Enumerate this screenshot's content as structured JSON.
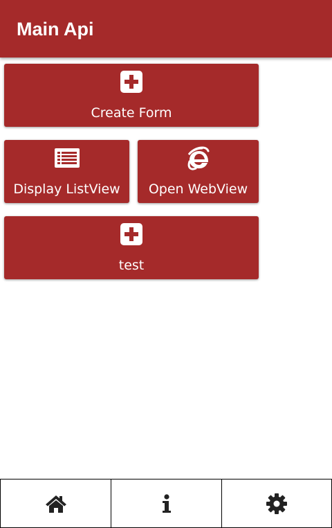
{
  "app": {
    "title": "Main Api"
  },
  "colors": {
    "primary": "#a52a2a",
    "on_primary": "#ffffff",
    "nav_icon": "#222222",
    "nav_border": "#000000",
    "background": "#ffffff"
  },
  "tiles": [
    {
      "label": "Create Form",
      "icon": "plus-square-icon"
    },
    {
      "label": "Display ListView",
      "icon": "list-icon"
    },
    {
      "label": "Open WebView",
      "icon": "internet-explorer-icon"
    },
    {
      "label": "test",
      "icon": "plus-square-icon"
    }
  ],
  "bottom_nav": [
    {
      "icon": "home-icon"
    },
    {
      "icon": "info-icon"
    },
    {
      "icon": "gear-icon"
    }
  ]
}
